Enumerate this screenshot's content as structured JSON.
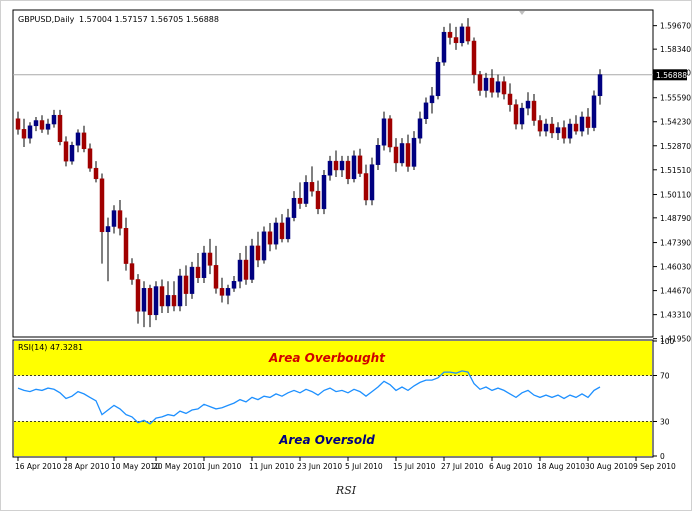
{
  "chart_data": {
    "type": "candlestick",
    "symbol_label": "GBPUSD,Daily",
    "ohlc_header": "1.57004 1.57157 1.56705 1.56888",
    "current_price": "1.56888",
    "price_ylim": [
      1.421,
      1.605
    ],
    "price_ticks": [
      "1.59670",
      "1.58340",
      "1.57010",
      "1.55590",
      "1.54230",
      "1.52870",
      "1.51510",
      "1.50110",
      "1.48790",
      "1.47390",
      "1.46030",
      "1.44670",
      "1.43310",
      "1.41950"
    ],
    "x_tick_labels": [
      "16 Apr 2010",
      "28 Apr 2010",
      "10 May 2010",
      "20 May 2010",
      "1 Jun 2010",
      "11 Jun 2010",
      "23 Jun 2010",
      "5 Jul 2010",
      "15 Jul 2010",
      "27 Jul 2010",
      "6 Aug 2010",
      "18 Aug 2010",
      "30 Aug 2010",
      "9 Sep 2010"
    ],
    "x_tick_bar_index": [
      0,
      8,
      16,
      23,
      31,
      39,
      47,
      55,
      63,
      71,
      79,
      87,
      95,
      103
    ],
    "bull_color": "#000080",
    "bear_color": "#a00000",
    "candles": [
      [
        1.544,
        1.548,
        1.535,
        1.538
      ],
      [
        1.538,
        1.544,
        1.528,
        1.533
      ],
      [
        1.533,
        1.542,
        1.53,
        1.54
      ],
      [
        1.54,
        1.545,
        1.537,
        1.543
      ],
      [
        1.543,
        1.546,
        1.536,
        1.538
      ],
      [
        1.538,
        1.544,
        1.535,
        1.541
      ],
      [
        1.541,
        1.549,
        1.539,
        1.546
      ],
      [
        1.546,
        1.549,
        1.529,
        1.531
      ],
      [
        1.531,
        1.534,
        1.517,
        1.52
      ],
      [
        1.52,
        1.531,
        1.518,
        1.529
      ],
      [
        1.529,
        1.538,
        1.525,
        1.536
      ],
      [
        1.536,
        1.54,
        1.525,
        1.527
      ],
      [
        1.527,
        1.53,
        1.514,
        1.516
      ],
      [
        1.516,
        1.52,
        1.508,
        1.51
      ],
      [
        1.51,
        1.513,
        1.462,
        1.48
      ],
      [
        1.48,
        1.488,
        1.452,
        1.483
      ],
      [
        1.483,
        1.495,
        1.479,
        1.492
      ],
      [
        1.492,
        1.498,
        1.478,
        1.482
      ],
      [
        1.482,
        1.488,
        1.458,
        1.462
      ],
      [
        1.462,
        1.465,
        1.45,
        1.453
      ],
      [
        1.453,
        1.456,
        1.428,
        1.435
      ],
      [
        1.435,
        1.452,
        1.426,
        1.448
      ],
      [
        1.448,
        1.45,
        1.426,
        1.433
      ],
      [
        1.433,
        1.452,
        1.43,
        1.449
      ],
      [
        1.449,
        1.453,
        1.434,
        1.438
      ],
      [
        1.438,
        1.452,
        1.434,
        1.444
      ],
      [
        1.444,
        1.452,
        1.435,
        1.438
      ],
      [
        1.438,
        1.459,
        1.435,
        1.455
      ],
      [
        1.455,
        1.461,
        1.438,
        1.445
      ],
      [
        1.445,
        1.463,
        1.442,
        1.46
      ],
      [
        1.46,
        1.468,
        1.451,
        1.454
      ],
      [
        1.454,
        1.472,
        1.451,
        1.468
      ],
      [
        1.468,
        1.476,
        1.456,
        1.461
      ],
      [
        1.461,
        1.472,
        1.445,
        1.448
      ],
      [
        1.448,
        1.454,
        1.44,
        1.444
      ],
      [
        1.444,
        1.45,
        1.439,
        1.448
      ],
      [
        1.448,
        1.455,
        1.446,
        1.452
      ],
      [
        1.452,
        1.468,
        1.448,
        1.464
      ],
      [
        1.464,
        1.472,
        1.45,
        1.453
      ],
      [
        1.453,
        1.476,
        1.451,
        1.472
      ],
      [
        1.472,
        1.48,
        1.46,
        1.464
      ],
      [
        1.464,
        1.483,
        1.462,
        1.48
      ],
      [
        1.48,
        1.485,
        1.469,
        1.473
      ],
      [
        1.473,
        1.488,
        1.47,
        1.485
      ],
      [
        1.485,
        1.49,
        1.474,
        1.476
      ],
      [
        1.476,
        1.493,
        1.474,
        1.488
      ],
      [
        1.488,
        1.503,
        1.486,
        1.499
      ],
      [
        1.499,
        1.508,
        1.493,
        1.496
      ],
      [
        1.496,
        1.512,
        1.494,
        1.508
      ],
      [
        1.508,
        1.517,
        1.5,
        1.503
      ],
      [
        1.503,
        1.509,
        1.49,
        1.493
      ],
      [
        1.493,
        1.515,
        1.49,
        1.512
      ],
      [
        1.512,
        1.523,
        1.509,
        1.52
      ],
      [
        1.52,
        1.526,
        1.511,
        1.515
      ],
      [
        1.515,
        1.523,
        1.511,
        1.52
      ],
      [
        1.52,
        1.523,
        1.507,
        1.51
      ],
      [
        1.51,
        1.526,
        1.508,
        1.523
      ],
      [
        1.523,
        1.527,
        1.511,
        1.513
      ],
      [
        1.513,
        1.518,
        1.495,
        1.498
      ],
      [
        1.498,
        1.522,
        1.495,
        1.518
      ],
      [
        1.518,
        1.533,
        1.515,
        1.529
      ],
      [
        1.529,
        1.548,
        1.526,
        1.544
      ],
      [
        1.544,
        1.546,
        1.525,
        1.528
      ],
      [
        1.528,
        1.533,
        1.514,
        1.519
      ],
      [
        1.519,
        1.533,
        1.517,
        1.53
      ],
      [
        1.53,
        1.535,
        1.514,
        1.517
      ],
      [
        1.517,
        1.537,
        1.515,
        1.533
      ],
      [
        1.533,
        1.548,
        1.53,
        1.544
      ],
      [
        1.544,
        1.556,
        1.541,
        1.553
      ],
      [
        1.553,
        1.562,
        1.547,
        1.557
      ],
      [
        1.557,
        1.579,
        1.555,
        1.576
      ],
      [
        1.576,
        1.596,
        1.574,
        1.593
      ],
      [
        1.593,
        1.598,
        1.586,
        1.59
      ],
      [
        1.59,
        1.596,
        1.583,
        1.587
      ],
      [
        1.587,
        1.598,
        1.585,
        1.596
      ],
      [
        1.596,
        1.601,
        1.586,
        1.588
      ],
      [
        1.588,
        1.59,
        1.564,
        1.569
      ],
      [
        1.569,
        1.571,
        1.557,
        1.56
      ],
      [
        1.56,
        1.57,
        1.556,
        1.567
      ],
      [
        1.567,
        1.572,
        1.556,
        1.559
      ],
      [
        1.559,
        1.569,
        1.556,
        1.565
      ],
      [
        1.565,
        1.568,
        1.555,
        1.558
      ],
      [
        1.558,
        1.564,
        1.548,
        1.552
      ],
      [
        1.552,
        1.555,
        1.538,
        1.541
      ],
      [
        1.541,
        1.553,
        1.538,
        1.55
      ],
      [
        1.55,
        1.559,
        1.546,
        1.554
      ],
      [
        1.554,
        1.558,
        1.54,
        1.543
      ],
      [
        1.543,
        1.546,
        1.534,
        1.537
      ],
      [
        1.537,
        1.544,
        1.534,
        1.541
      ],
      [
        1.541,
        1.545,
        1.533,
        1.536
      ],
      [
        1.536,
        1.542,
        1.532,
        1.539
      ],
      [
        1.539,
        1.543,
        1.53,
        1.533
      ],
      [
        1.533,
        1.544,
        1.53,
        1.541
      ],
      [
        1.541,
        1.546,
        1.535,
        1.537
      ],
      [
        1.537,
        1.548,
        1.534,
        1.545
      ],
      [
        1.545,
        1.55,
        1.535,
        1.539
      ],
      [
        1.539,
        1.56,
        1.537,
        1.557
      ],
      [
        1.557,
        1.572,
        1.552,
        1.569
      ]
    ],
    "rsi": {
      "label": "RSI(14) 47.3281",
      "ylim": [
        0,
        100
      ],
      "ticks": [
        "100",
        "70",
        "30",
        "0"
      ],
      "tick_values": [
        100,
        70,
        30,
        0
      ],
      "overbought": 70,
      "oversold": 30,
      "zone_color": "#ffff00",
      "line_color": "#1e90ff",
      "overbought_text": "Area Overbought",
      "oversold_text": "Area Oversold",
      "values": [
        59,
        57,
        56,
        58,
        57,
        59,
        58,
        55,
        50,
        52,
        56,
        54,
        51,
        48,
        36,
        40,
        44,
        41,
        36,
        34,
        29,
        31,
        28,
        33,
        34,
        36,
        35,
        39,
        37,
        40,
        41,
        45,
        43,
        41,
        42,
        44,
        46,
        49,
        47,
        51,
        49,
        52,
        51,
        54,
        52,
        55,
        57,
        55,
        58,
        56,
        53,
        57,
        59,
        56,
        57,
        55,
        58,
        56,
        52,
        56,
        60,
        65,
        62,
        57,
        60,
        57,
        61,
        64,
        66,
        66,
        68,
        73,
        73,
        72,
        74,
        73,
        63,
        58,
        60,
        57,
        59,
        57,
        54,
        51,
        55,
        57,
        53,
        51,
        53,
        51,
        53,
        50,
        53,
        51,
        54,
        51,
        57,
        60
      ]
    },
    "caption": "RSI"
  }
}
